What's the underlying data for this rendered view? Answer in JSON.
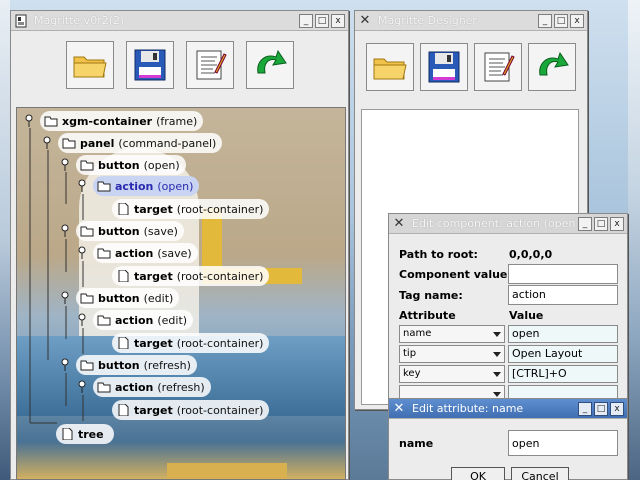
{
  "colors": {
    "accent_title": "#4a7cc0",
    "selected_node": "#c9d4f2"
  },
  "main_window": {
    "title": "Magritte v0r2(2)",
    "title_buttons": [
      "_",
      "□",
      "x"
    ],
    "toolbar": [
      "folder-open-icon",
      "floppy-save-icon",
      "edit-notes-icon",
      "refresh-arrow-icon"
    ],
    "tree": [
      {
        "name": "xgm-container",
        "type": "(frame)",
        "icon": "folder-icon",
        "pin": true
      },
      {
        "name": "panel",
        "type": "(command-panel)",
        "icon": "folder-icon",
        "pin": true
      },
      {
        "name": "button",
        "type": "(open)",
        "icon": "folder-icon",
        "pin": true
      },
      {
        "name": "action",
        "type": "(open)",
        "icon": "folder-icon",
        "pin": true,
        "selected": true
      },
      {
        "name": "target",
        "type": "(root-container)",
        "icon": "file-icon",
        "pin": false
      },
      {
        "name": "button",
        "type": "(save)",
        "icon": "folder-icon",
        "pin": true
      },
      {
        "name": "action",
        "type": "(save)",
        "icon": "folder-icon",
        "pin": true
      },
      {
        "name": "target",
        "type": "(root-container)",
        "icon": "file-icon",
        "pin": false
      },
      {
        "name": "button",
        "type": "(edit)",
        "icon": "folder-icon",
        "pin": true
      },
      {
        "name": "action",
        "type": "(edit)",
        "icon": "folder-icon",
        "pin": true
      },
      {
        "name": "target",
        "type": "(root-container)",
        "icon": "file-icon",
        "pin": false
      },
      {
        "name": "button",
        "type": "(refresh)",
        "icon": "folder-icon",
        "pin": true
      },
      {
        "name": "action",
        "type": "(refresh)",
        "icon": "folder-icon",
        "pin": true
      },
      {
        "name": "target",
        "type": "(root-container)",
        "icon": "file-icon",
        "pin": false
      },
      {
        "name": "tree",
        "type": "",
        "icon": "file-icon",
        "pin": false
      }
    ]
  },
  "designer_window": {
    "title": "Magritte Designer",
    "title_buttons": [
      "_",
      "□",
      "x"
    ]
  },
  "edit_component": {
    "title": "Edit component: action (open)",
    "title_buttons": [
      "_",
      "□",
      "x"
    ],
    "path_label": "Path to root:",
    "path_value": "0,0,0,0",
    "component_value_label": "Component value:",
    "component_value": "",
    "tag_name_label": "Tag name:",
    "tag_name_value": "action",
    "attribute_header": "Attribute",
    "value_header": "Value",
    "attributes": [
      {
        "name": "name",
        "value": "open"
      },
      {
        "name": "tip",
        "value": "Open Layout"
      },
      {
        "name": "key",
        "value": "[CTRL]+O"
      },
      {
        "name": "",
        "value": ""
      }
    ]
  },
  "edit_attribute": {
    "title": "Edit attribute: name",
    "title_buttons": [
      "_",
      "□",
      "x"
    ],
    "name_label": "name",
    "name_value": "open",
    "ok_label": "OK",
    "cancel_label": "Cancel"
  }
}
